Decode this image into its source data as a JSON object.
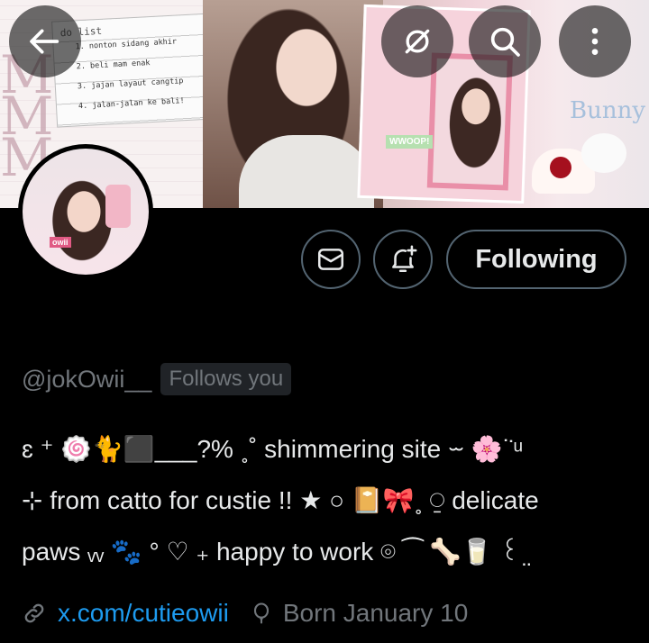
{
  "banner": {
    "note_title": "do list",
    "note_items": [
      "1. nonton sidang akhir",
      "2. beli mam enak",
      "3. jajan layaut cangtip",
      "4. jalan-jalan ke bali!"
    ],
    "sticker_text": "WWOOP!",
    "bunny_text": "Bunny",
    "avatar_sticker": "owii"
  },
  "profile": {
    "handle": "@jokOwii__",
    "follows_you": "Follows you",
    "following_label": "Following",
    "bio_lines": [
      "ɛ ⁺ 🍥🐈⬛___?% ˳˚ shimmering site ⏖ 🌸˙̇ ͧ",
      "⊹ from catto for custie !! ★ ○ 📔🎀˳ ⍜ delicate",
      "paws ᵥᵥ 🐾 ° ♡ ₊ happy to work ⌾ ⁀ 🦴🥛 ꒰ ̤"
    ],
    "website": "x.com/cutieowii",
    "birthday": "Born January 10"
  },
  "icons": {
    "back": "arrow-left-icon",
    "grok": "grok-icon",
    "search": "search-icon",
    "more": "more-vertical-icon",
    "message": "envelope-icon",
    "notify": "bell-plus-icon",
    "link": "link-icon",
    "birthday": "balloon-icon"
  },
  "colors": {
    "background": "#000000",
    "text": "#e7e9ea",
    "muted": "#71767b",
    "link": "#1d9bf0",
    "border": "#536471"
  }
}
